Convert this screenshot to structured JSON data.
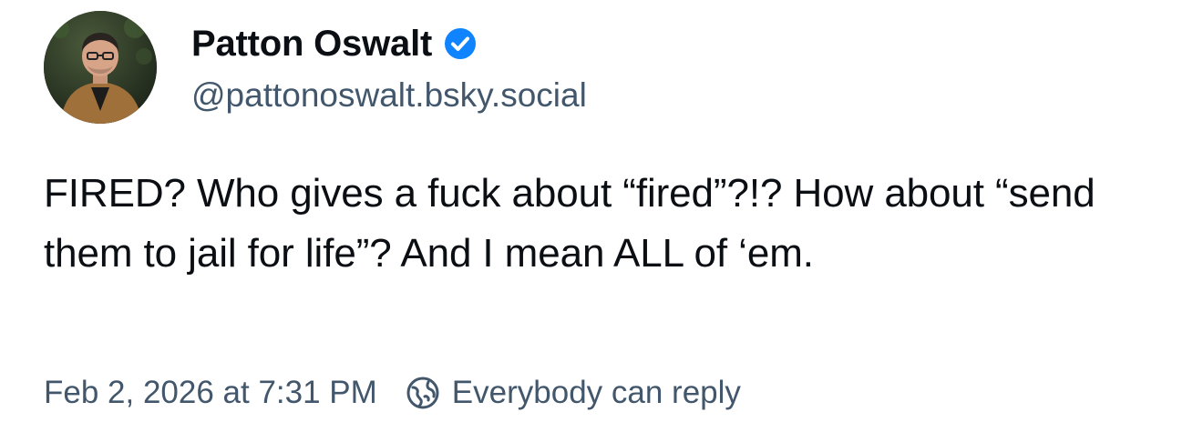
{
  "author": {
    "display_name": "Patton Oswalt",
    "handle": "@pattonoswalt.bsky.social",
    "verified_icon": "verified-check-icon",
    "avatar_icon": "avatar-photo"
  },
  "post": {
    "text": "FIRED? Who gives a fuck about “fired”?!? How about “send them to jail for life”? And I mean ALL of ‘em.",
    "timestamp": "Feb 2, 2026 at 7:31 PM",
    "reply_setting_label": "Everybody can reply",
    "reply_setting_icon": "globe-icon"
  },
  "colors": {
    "text_primary": "#0b0f14",
    "text_secondary": "#42576c",
    "verified_blue": "#1083fe",
    "background": "#ffffff"
  }
}
